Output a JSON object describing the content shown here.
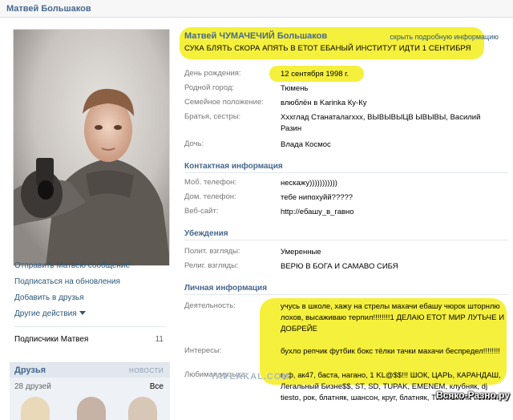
{
  "header": {
    "name": "Матвей Большаков"
  },
  "left": {
    "actions": [
      {
        "label": "Отправить Матвею сообщение"
      },
      {
        "label": "Подписаться на обновления"
      },
      {
        "label": "Добавить в друзья"
      },
      {
        "label": "Другие действия"
      }
    ],
    "subscribers": {
      "label": "Подписчики Матвея",
      "count": "11"
    },
    "friends": {
      "title": "Друзья",
      "news": "НОВОСТИ",
      "count": "28 друзей",
      "all": "Все"
    }
  },
  "profile": {
    "full_name": "Матвей ЧУМАЧЕЧИЙ Большаков",
    "hide_link": "скрыть подробную информацию",
    "status": "СУКА БЛЯТЬ СКОРА АПЯТЬ В ЕТОТ ЕБАНЫЙ ИНСТИТУТ ИДТИ 1 СЕНТИБРЯ",
    "basic": [
      {
        "label": "День рождения:",
        "value": "12 сентября 1998 г."
      },
      {
        "label": "Родной город:",
        "value": "Тюмень"
      },
      {
        "label": "Семейное положение:",
        "value": "влюблён в Karinka Ку-Ку"
      },
      {
        "label": "Братья, сестры:",
        "value": "Ххxглад Станаталагххх, ВЫВЫВЫЦВ ЫВЫВЫ, Василий Разин"
      },
      {
        "label": "Дочь:",
        "value": "Влада Космос"
      }
    ],
    "contact_title": "Контактная информация",
    "contact": [
      {
        "label": "Моб. телефон:",
        "value": "нескажу)))))))))))"
      },
      {
        "label": "Дом. телефон:",
        "value": "тебе нипохуйй?????"
      },
      {
        "label": "Веб-сайт:",
        "value": "http://ебашу_в_гавно"
      }
    ],
    "beliefs_title": "Убеждения",
    "beliefs": [
      {
        "label": "Полит. взгляды:",
        "value": "Умеренные"
      },
      {
        "label": "Религ. взгляды:",
        "value": "ВЕРЮ В БОГА И САМАВО СИБЯ"
      }
    ],
    "personal_title": "Личная информация",
    "personal": [
      {
        "label": "Деятельность:",
        "value": "учусь в школе, хажу на стрелы махачи ебашу чюрок шторнлю лохов, высаживаю терпил!!!!!!!!1 ДЕЛАЮ ЕТОТ МИР ЛУТЬЧЕ И ДОБРЕЙЕ"
      },
      {
        "label": "Интересы:",
        "value": "бухло репчик футбик бокс тёлки тачки махачи беспредел!!!!!!!!"
      },
      {
        "label": "Любимая музыка:",
        "value": "гуф, ак47, баста, нагано, 1 KL@$$!!! ШОК, ЦАРЬ, КАРАНДАШ, Легальный Бизне$$, ST, SD, TUPAK, EMENEM, клубняк, dj tiesto, рок, блатняк, шансон, круг, блатняк, ТИКТОНИК РУЛИТ"
      }
    ]
  },
  "watermark": "Всяко-Разно.ру",
  "watermark2": "YAPLAKAL.COM",
  "colors": {
    "accent": "#45688e",
    "link": "#2b587a",
    "highlight": "#f4ef2a"
  }
}
